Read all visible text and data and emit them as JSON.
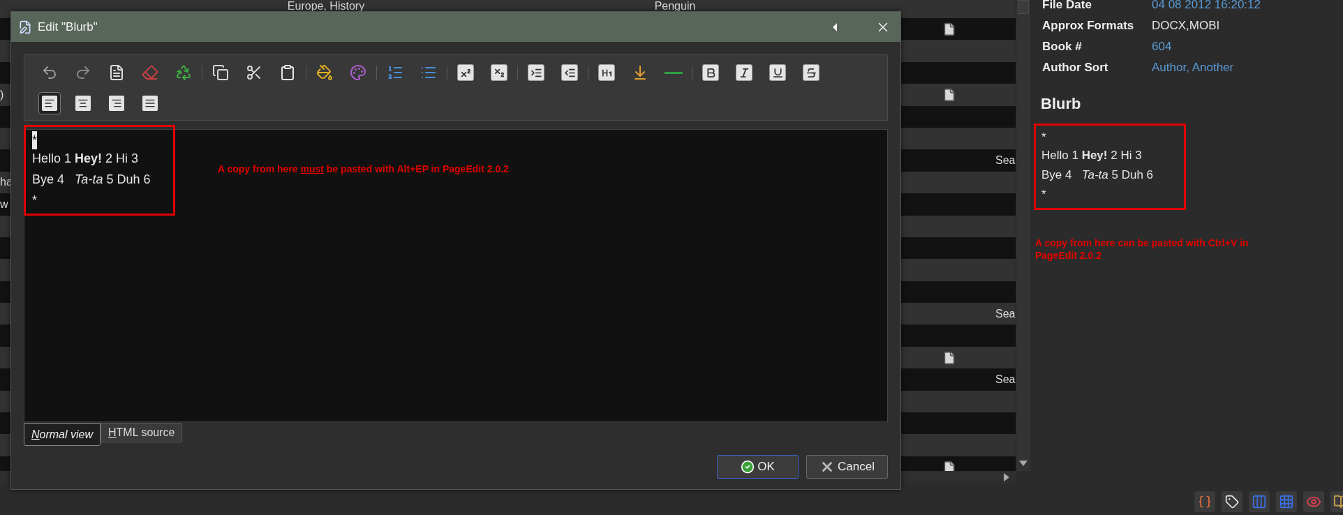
{
  "background_table": {
    "rows": [
      {
        "column_2": "Europe, History",
        "column_3": "Penguin",
        "file_icon": false
      },
      {
        "file_icon": true
      },
      {
        "file_icon": false
      },
      {
        "file_icon": false
      },
      {
        "column_1": ")",
        "file_icon": true
      },
      {
        "file_icon": false
      },
      {
        "file_icon": false
      },
      {
        "column_6": "Sea",
        "file_icon": false
      },
      {
        "column_1": "ha",
        "file_icon": false
      },
      {
        "column_1": "w",
        "file_icon": false
      },
      {
        "file_icon": false
      },
      {
        "file_icon": false
      },
      {
        "file_icon": false
      },
      {
        "file_icon": false
      },
      {
        "column_6": "Sea",
        "file_icon": false
      },
      {
        "file_icon": false
      },
      {
        "file_icon": true
      },
      {
        "column_6": "Sea",
        "file_icon": false
      },
      {
        "file_icon": false
      },
      {
        "file_icon": false
      },
      {
        "file_icon": false
      },
      {
        "file_icon": true
      }
    ]
  },
  "details": {
    "fields": [
      {
        "label": "File Date",
        "value": "04 08 2012 16:20:12",
        "link": true
      },
      {
        "label": "Approx Formats",
        "value": "DOCX,MOBI",
        "link": false
      },
      {
        "label": "Book #",
        "value": "604",
        "link": true
      },
      {
        "label": "Author Sort",
        "value": "Author, Another",
        "link": true
      }
    ],
    "blurb_heading": "Blurb",
    "blurb_lines": [
      "*",
      "Hello 1 **Hey!** 2 Hi 3",
      "Bye 4   *Ta-ta* 5 Duh 6",
      "*"
    ],
    "note": "A copy from here can be pasted with Ctrl+V in PageEdit 2.0.2"
  },
  "dialog": {
    "title": "Edit \"Blurb\"",
    "toolbar": {
      "alignment_buttons": [
        {
          "selected": true
        },
        {
          "selected": false
        },
        {
          "selected": false
        },
        {
          "selected": false
        }
      ]
    },
    "editor": {
      "lines": [
        {
          "text": "*",
          "highlighted": true
        },
        {
          "text": "Hello 1 **Hey!** 2 Hi 3",
          "highlighted": false
        },
        {
          "text": "Bye 4   *Ta-ta* 5 Duh 6",
          "highlighted": false
        },
        {
          "text": "*",
          "highlighted": false
        }
      ],
      "note_parts": [
        {
          "text": "A copy from here ",
          "underline": false
        },
        {
          "text": "must",
          "underline": true
        },
        {
          "text": " be pasted with Alt+EP in PageEdit 2.0.2",
          "underline": false
        }
      ]
    },
    "tabs": [
      {
        "label": "Normal view",
        "selected": true
      },
      {
        "label": "HTML source",
        "selected": false
      }
    ],
    "buttons": [
      {
        "label": "OK",
        "kind": "ok"
      },
      {
        "label": "Cancel",
        "kind": "cancel"
      }
    ]
  }
}
